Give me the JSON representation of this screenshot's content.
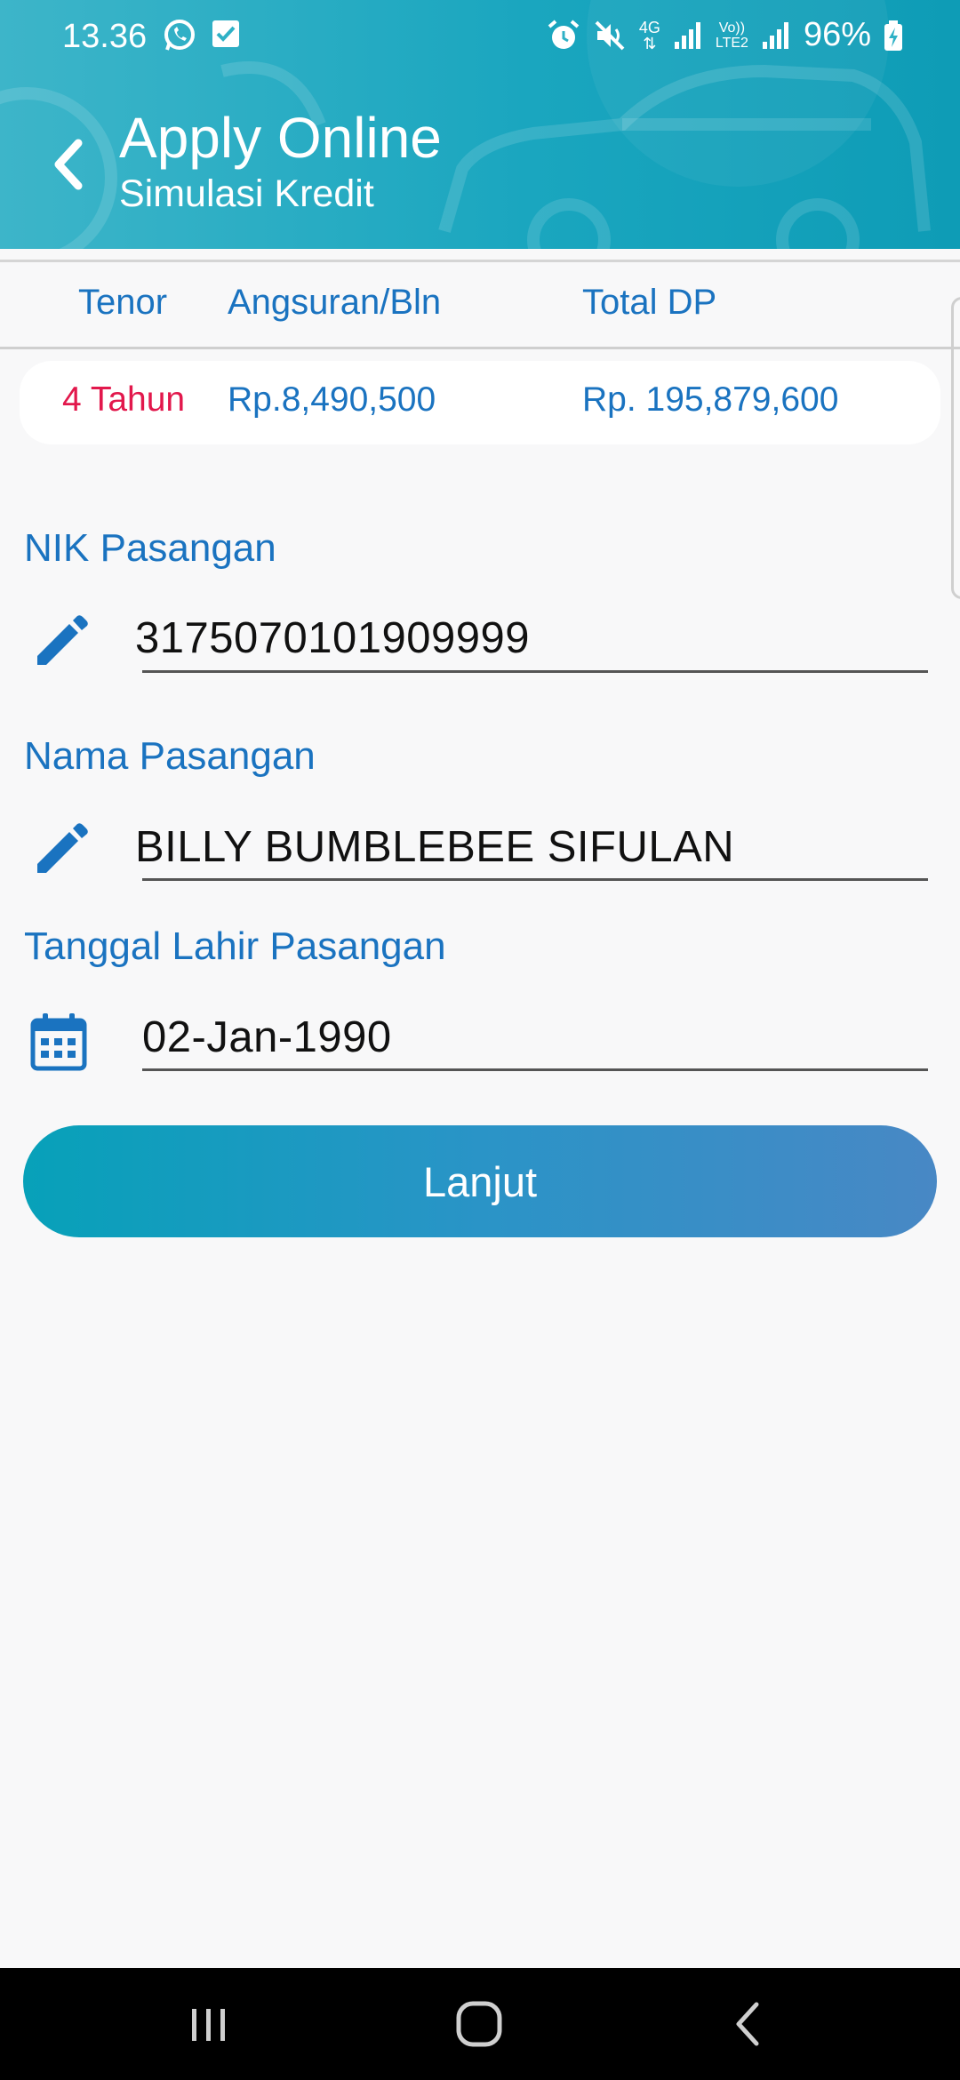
{
  "status_bar": {
    "time": "13.36",
    "left_icons": [
      "whatsapp-icon",
      "checkbox-notification-icon"
    ],
    "right_icons": [
      "alarm-icon",
      "mute-icon",
      "4g-icon",
      "signal-icon",
      "volte-icon",
      "signal-icon"
    ],
    "signal_4g": "4G",
    "volte_top": "Vo))",
    "volte_bottom": "LTE2",
    "battery": "96%"
  },
  "header": {
    "title": "Apply Online",
    "subtitle": "Simulasi Kredit",
    "back_icon": "chevron-left-icon",
    "color_start": "#3db5c9",
    "color_end": "#0e9cb6"
  },
  "table": {
    "columns": [
      "Tenor",
      "Angsuran/Bln",
      "Total DP"
    ],
    "row": [
      "4 Tahun",
      "Rp.8,490,500",
      "Rp. 195,879,600"
    ],
    "accent_color": "#1a73c0",
    "highlight_color": "#e2184c"
  },
  "form": {
    "fields": [
      {
        "label": "NIK Pasangan",
        "value": "3175070101909999",
        "icon": "pencil-icon"
      },
      {
        "label": "Nama Pasangan",
        "value": "BILLY BUMBLEBEE SIFULAN",
        "icon": "pencil-icon"
      },
      {
        "label": "Tanggal Lahir Pasangan",
        "value": "02-Jan-1990",
        "icon": "calendar-icon"
      }
    ],
    "submit_label": "Lanjut"
  },
  "nav_bar": {
    "buttons": [
      "recent-apps-icon",
      "home-icon",
      "back-icon"
    ]
  }
}
